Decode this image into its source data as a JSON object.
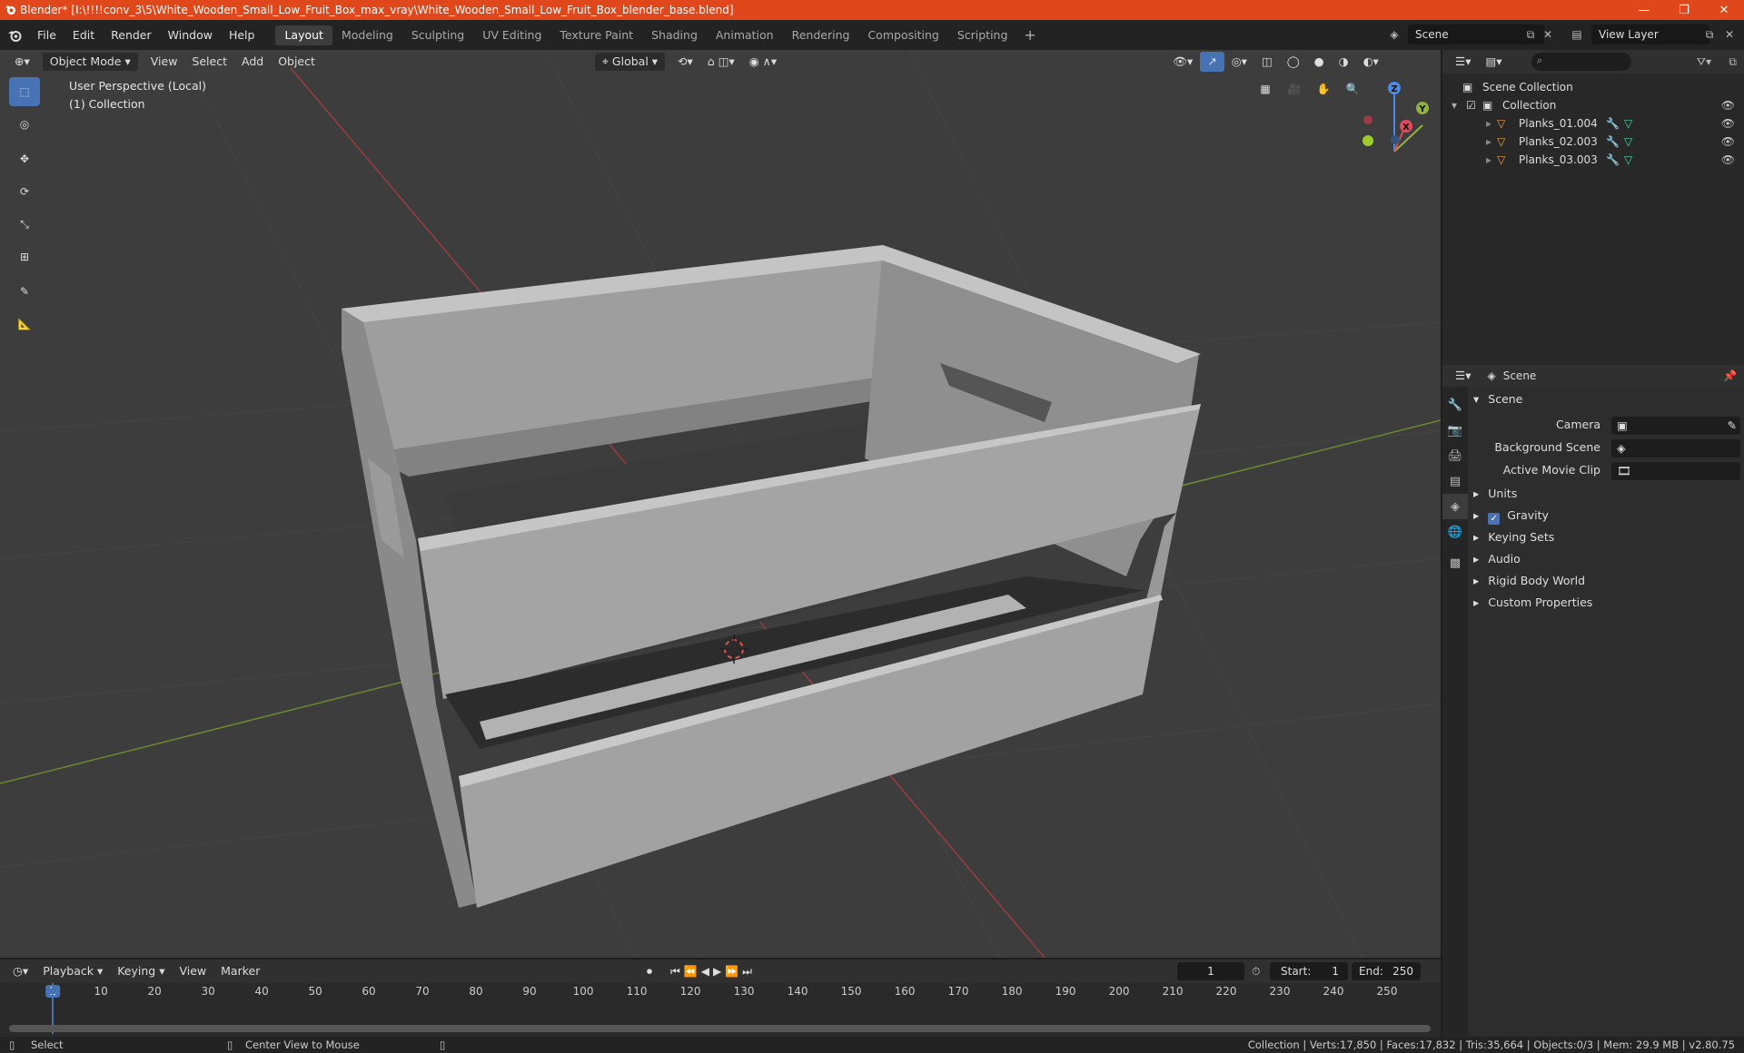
{
  "window": {
    "title": "Blender* [I:\\!!!!conv_3\\5\\White_Wooden_Small_Low_Fruit_Box_max_vray\\White_Wooden_Small_Low_Fruit_Box_blender_base.blend]",
    "minimize": "—",
    "restore": "❐",
    "close": "✕"
  },
  "menu": {
    "items": [
      "File",
      "Edit",
      "Render",
      "Window",
      "Help"
    ]
  },
  "workspaces": [
    "Layout",
    "Modeling",
    "Sculpting",
    "UV Editing",
    "Texture Paint",
    "Shading",
    "Animation",
    "Rendering",
    "Compositing",
    "Scripting"
  ],
  "workspace_add": "+",
  "scene_name": "Scene",
  "view_layer": "View Layer",
  "viewport": {
    "mode": "Object Mode",
    "menus": [
      "View",
      "Select",
      "Add",
      "Object"
    ],
    "orientation": "Global",
    "info_line1": "User Perspective (Local)",
    "info_line2": "(1) Collection",
    "gizmo": {
      "x": "X",
      "y": "Y",
      "z": "Z"
    }
  },
  "outliner": {
    "root": "Scene Collection",
    "collection": "Collection",
    "objects": [
      "Planks_01.004",
      "Planks_02.003",
      "Planks_03.003"
    ]
  },
  "properties": {
    "header_title": "Scene",
    "panel_title": "Scene",
    "camera_label": "Camera",
    "background_scene_label": "Background Scene",
    "active_clip_label": "Active Movie Clip",
    "subpanels": [
      "Units",
      "Gravity",
      "Keying Sets",
      "Audio",
      "Rigid Body World",
      "Custom Properties"
    ],
    "gravity_checked": true
  },
  "timeline": {
    "menus": [
      "Playback",
      "Keying",
      "View",
      "Marker"
    ],
    "current_frame": "1",
    "start_label": "Start:",
    "start": "1",
    "end_label": "End:",
    "end": "250",
    "ticks": [
      "1",
      "10",
      "20",
      "30",
      "40",
      "50",
      "60",
      "70",
      "80",
      "90",
      "100",
      "110",
      "120",
      "130",
      "140",
      "150",
      "160",
      "170",
      "180",
      "190",
      "200",
      "210",
      "220",
      "230",
      "240",
      "250"
    ]
  },
  "status": {
    "select": "Select",
    "center_view": "Center View to Mouse",
    "stats": "Collection | Verts:17,850 | Faces:17,832 | Tris:35,664 | Objects:0/3 | Mem: 29.9 MB | v2.80.75"
  },
  "colors": {
    "title_bar": "#e0471a",
    "accent": "#4772b3",
    "x_axis": "#e54856",
    "y_axis": "#8fb33d",
    "z_axis": "#4a8ae8"
  }
}
